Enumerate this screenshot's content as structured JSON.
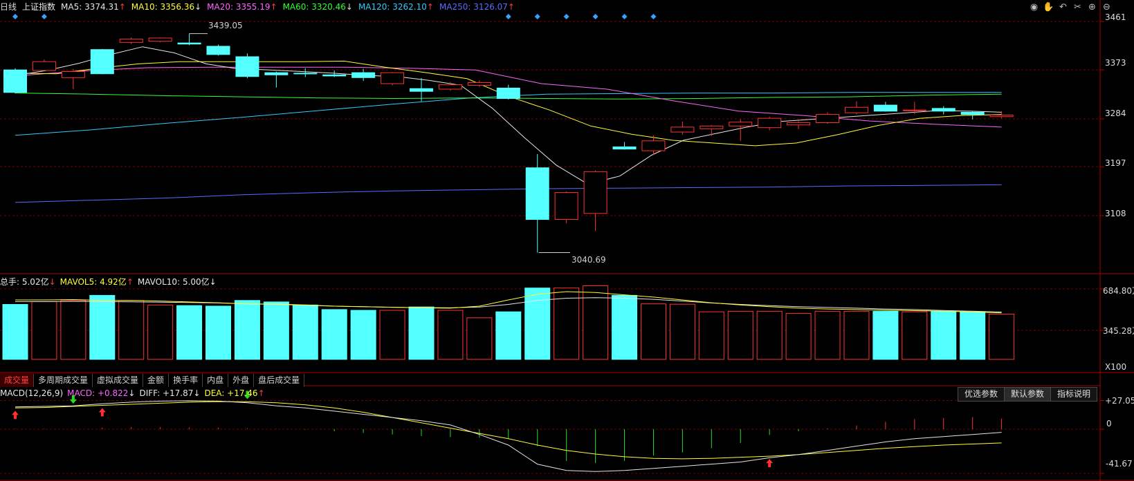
{
  "price_header": {
    "period": "日线",
    "name": "上证指数",
    "items": [
      {
        "label": "MA5: ",
        "value": "3374.31",
        "dir": "↑",
        "color": "#e6e6e6"
      },
      {
        "label": "MA10: ",
        "value": "3356.36",
        "dir": "↓",
        "color": "#ffff33"
      },
      {
        "label": "MA20: ",
        "value": "3355.19",
        "dir": "↑",
        "color": "#ff66ff"
      },
      {
        "label": "MA60: ",
        "value": "3320.46",
        "dir": "↓",
        "color": "#33ff33"
      },
      {
        "label": "MA120: ",
        "value": "3262.10",
        "dir": "↑",
        "color": "#33ccff"
      },
      {
        "label": "MA250: ",
        "value": "3126.07",
        "dir": "↑",
        "color": "#5b6bff"
      }
    ]
  },
  "toolbar_icons": [
    "eye-icon",
    "hand-icon",
    "undo-icon",
    "scissors-icon",
    "zoom-in-icon",
    "zoom-out-icon"
  ],
  "toolbar_glyphs": [
    "◉",
    "✋",
    "↶",
    "✂",
    "⊕",
    "⊖"
  ],
  "price_axis": [
    "3461",
    "3373",
    "3284",
    "3197",
    "3108"
  ],
  "annotations": {
    "high": "3439.05",
    "low": "3040.69"
  },
  "volume_header": {
    "total_label": "总手: ",
    "total_value": "5.02亿",
    "total_dir": "↓",
    "mavol5_label": "MAVOL5: ",
    "mavol5_value": "4.92亿",
    "mavol5_dir": "↑",
    "mavol10_label": "MAVOL10: ",
    "mavol10_value": "5.00亿",
    "mavol10_dir": "↓"
  },
  "volume_axis": [
    "684.80万",
    "345.28万",
    "X100"
  ],
  "tabs": [
    "成交量",
    "多周期成交量",
    "虚拟成交量",
    "金额",
    "换手率",
    "内盘",
    "外盘",
    "盘后成交量"
  ],
  "macd_header": {
    "name": "MACD(12,26,9)",
    "macd_label": "MACD: ",
    "macd_value": "+0.822",
    "macd_dir": "↓",
    "diff_label": "DIFF: ",
    "diff_value": "+17.87",
    "diff_dir": "↓",
    "dea_label": "DEA: ",
    "dea_value": "+17.46",
    "dea_dir": "↑"
  },
  "param_buttons": [
    "优选参数",
    "默认参数",
    "指标说明"
  ],
  "macd_axis": [
    "+27.05",
    "0",
    "-41.67"
  ],
  "colors": {
    "up": "#ff3232",
    "down": "#54ffff",
    "ma5": "#e6e6e6",
    "ma10": "#ffff33",
    "ma20": "#ff66ff",
    "ma60": "#33ff33",
    "ma120": "#33ccff",
    "ma250": "#5b6bff",
    "grid": "#7a0000",
    "border": "#aa0000"
  },
  "chart_data": {
    "type": "candlestick",
    "price_ylim": [
      3020,
      3475
    ],
    "candles": [
      {
        "o": 3373,
        "c": 3332,
        "h": 3376,
        "l": 3330
      },
      {
        "o": 3372,
        "c": 3388,
        "h": 3392,
        "l": 3372
      },
      {
        "o": 3359,
        "c": 3370,
        "h": 3375,
        "l": 3338
      },
      {
        "o": 3410,
        "c": 3366,
        "h": 3411,
        "l": 3365
      },
      {
        "o": 3423,
        "c": 3429,
        "h": 3432,
        "l": 3420
      },
      {
        "o": 3425,
        "c": 3431,
        "h": 3432,
        "l": 3423
      },
      {
        "o": 3422,
        "c": 3420,
        "h": 3439.05,
        "l": 3418
      },
      {
        "o": 3416,
        "c": 3401,
        "h": 3419,
        "l": 3399
      },
      {
        "o": 3397,
        "c": 3361,
        "h": 3403,
        "l": 3358
      },
      {
        "o": 3368,
        "c": 3364,
        "h": 3370,
        "l": 3341
      },
      {
        "o": 3367,
        "c": 3366,
        "h": 3376,
        "l": 3360
      },
      {
        "o": 3364,
        "c": 3362,
        "h": 3372,
        "l": 3360
      },
      {
        "o": 3368,
        "c": 3359,
        "h": 3375,
        "l": 3353
      },
      {
        "o": 3348,
        "c": 3368,
        "h": 3369,
        "l": 3345
      },
      {
        "o": 3339,
        "c": 3334,
        "h": 3358,
        "l": 3316
      },
      {
        "o": 3338,
        "c": 3346,
        "h": 3351,
        "l": 3335
      },
      {
        "o": 3345,
        "c": 3350,
        "h": 3354,
        "l": 3342
      },
      {
        "o": 3340,
        "c": 3321,
        "h": 3346,
        "l": 3319
      },
      {
        "o": 3195,
        "c": 3101,
        "h": 3220,
        "l": 3040.69
      },
      {
        "o": 3101,
        "c": 3150,
        "h": 3152,
        "l": 3094
      },
      {
        "o": 3112,
        "c": 3188,
        "h": 3190,
        "l": 3080
      },
      {
        "o": 3233,
        "c": 3229,
        "h": 3242,
        "l": 3228
      },
      {
        "o": 3226,
        "c": 3244,
        "h": 3254,
        "l": 3218
      },
      {
        "o": 3260,
        "c": 3269,
        "h": 3279,
        "l": 3255
      },
      {
        "o": 3266,
        "c": 3271,
        "h": 3273,
        "l": 3253
      },
      {
        "o": 3271,
        "c": 3278,
        "h": 3283,
        "l": 3244
      },
      {
        "o": 3268,
        "c": 3285,
        "h": 3288,
        "l": 3263
      },
      {
        "o": 3273,
        "c": 3277,
        "h": 3280,
        "l": 3265
      },
      {
        "o": 3277,
        "c": 3292,
        "h": 3296,
        "l": 3275
      },
      {
        "o": 3295,
        "c": 3305,
        "h": 3316,
        "l": 3292
      },
      {
        "o": 3309,
        "c": 3298,
        "h": 3315,
        "l": 3297
      },
      {
        "o": 3299,
        "c": 3300,
        "h": 3315,
        "l": 3293
      },
      {
        "o": 3303,
        "c": 3298,
        "h": 3307,
        "l": 3292
      },
      {
        "o": 3296,
        "c": 3292,
        "h": 3298,
        "l": 3283
      },
      {
        "o": 3288,
        "c": 3291,
        "h": 3298,
        "l": 3285
      }
    ],
    "ma5": [
      3363,
      3372,
      3385,
      3401,
      3415,
      3404,
      3384,
      3375,
      3373,
      3370,
      3367,
      3363,
      3361,
      3354,
      3345,
      3303,
      3250,
      3200,
      3165,
      3180,
      3218,
      3245,
      3257,
      3269,
      3279,
      3283,
      3287,
      3291,
      3295,
      3299,
      3298,
      3296
    ],
    "ma10": [
      3367,
      3366,
      3376,
      3384,
      3388,
      3388,
      3388,
      3388,
      3389,
      3378,
      3368,
      3357,
      3325,
      3300,
      3271,
      3256,
      3245,
      3240,
      3235,
      3240,
      3255,
      3272,
      3285,
      3290,
      3292
    ],
    "ma20": [
      3362,
      3371,
      3377,
      3378,
      3378,
      3378,
      3376,
      3373,
      3348,
      3338,
      3317,
      3298,
      3290,
      3280,
      3274,
      3269
    ],
    "ma60": [
      3331,
      3329,
      3326,
      3324,
      3322,
      3321,
      3322,
      3321,
      3320,
      3321,
      3323,
      3324,
      3327,
      3329
    ],
    "ma120": [
      3254,
      3264,
      3276,
      3287,
      3299,
      3311,
      3322,
      3329,
      3330,
      3331,
      3331,
      3332,
      3332,
      3332
    ],
    "ma250": [
      3132,
      3136,
      3140,
      3146,
      3150,
      3153,
      3155,
      3157,
      3158,
      3159,
      3160,
      3162,
      3163,
      3164
    ],
    "volume_ylim": [
      0,
      720
    ],
    "volumes": [
      485,
      510,
      520,
      565,
      520,
      480,
      475,
      470,
      520,
      507,
      480,
      440,
      433,
      433,
      463,
      433,
      367,
      420,
      630,
      630,
      650,
      565,
      490,
      487,
      420,
      425,
      425,
      405,
      425,
      425,
      425,
      420,
      425,
      420,
      400
    ],
    "mavol5": [
      525,
      525,
      528,
      520,
      520,
      515,
      507,
      500,
      490,
      488,
      480,
      470,
      465,
      460,
      455,
      452,
      470,
      525,
      575,
      598,
      590,
      570,
      550,
      525,
      500,
      480,
      465,
      452,
      445,
      440,
      435,
      430,
      425,
      418,
      410
    ],
    "mavol10": [
      510,
      510,
      512,
      510,
      508,
      505,
      502,
      498,
      490,
      486,
      478,
      470,
      465,
      460,
      457,
      455,
      462,
      485,
      520,
      540,
      545,
      540,
      530,
      515,
      498,
      485,
      475,
      465,
      458,
      452,
      445,
      440,
      432,
      425,
      418
    ],
    "macd_ylim": [
      -45,
      30
    ],
    "macd_hist": [
      0.4,
      0.5,
      0.3,
      1.5,
      2.0,
      2.0,
      1.8,
      1.5,
      0.8,
      0.3,
      -0.3,
      -2.0,
      -3.5,
      -5.0,
      -6.5,
      -7.5,
      -8.0,
      -8.5,
      -16,
      -30,
      -32,
      -30,
      -25,
      -22,
      -18,
      -13,
      -5.5,
      -2.0,
      0.6,
      3.5,
      7.0,
      9.5,
      10.5,
      11.5,
      10.0
    ],
    "diff": [
      21,
      21.5,
      22,
      24,
      25.5,
      26.5,
      26.8,
      26.5,
      25,
      22,
      20,
      17,
      14,
      11,
      8,
      4,
      -5,
      -15,
      -33,
      -39,
      -40,
      -39,
      -37,
      -35,
      -33,
      -31,
      -27,
      -24,
      -20,
      -16,
      -12,
      -9,
      -7,
      -5,
      -3
    ],
    "dea": [
      20,
      20.5,
      21.5,
      22.5,
      23.5,
      24.5,
      25.5,
      26,
      25.8,
      25,
      23,
      20,
      16,
      11,
      6,
      1,
      -4,
      -9,
      -15,
      -20,
      -23.5,
      -26,
      -27.5,
      -28,
      -27.5,
      -26.5,
      -25.5,
      -24,
      -22,
      -20,
      -18,
      -16.5,
      -15,
      -14,
      -13
    ],
    "macd_marks": [
      {
        "i": 0,
        "dir": "up"
      },
      {
        "i": 2,
        "dir": "down"
      },
      {
        "i": 3,
        "dir": "up"
      },
      {
        "i": 8,
        "dir": "down"
      },
      {
        "i": 26,
        "dir": "up"
      }
    ],
    "event_marks": [
      0,
      1,
      17,
      18,
      19,
      20,
      21,
      22
    ]
  }
}
